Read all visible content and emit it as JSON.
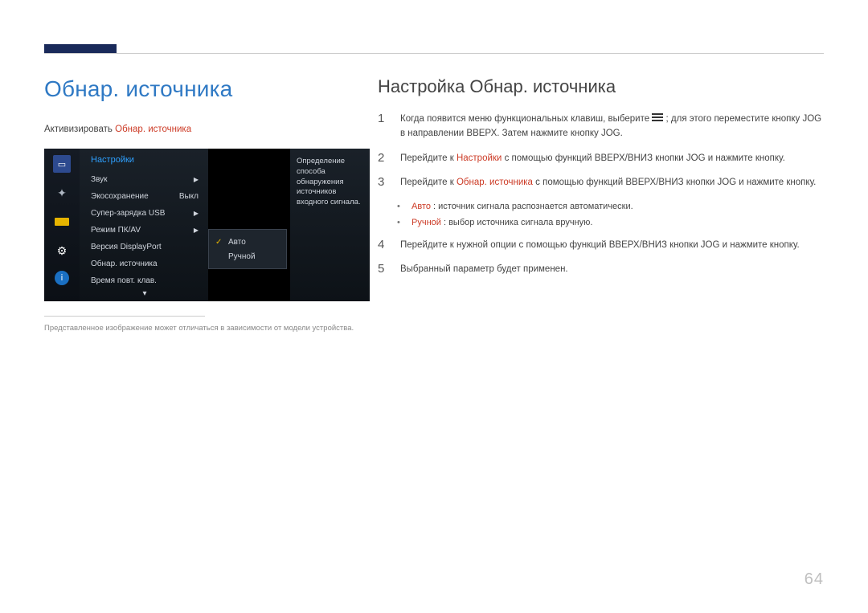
{
  "topic_title": "Обнар. источника",
  "activate_label": "Активизировать",
  "activate_path": "Обнар. источника",
  "osd": {
    "title": "Настройки",
    "rows": [
      {
        "label": "Звук",
        "value_kind": "arrow"
      },
      {
        "label": "Экосохранение",
        "value_kind": "text",
        "value": "Выкл"
      },
      {
        "label": "Супер-зарядка USB",
        "value_kind": "arrow"
      },
      {
        "label": "Режим ПК/AV",
        "value_kind": "arrow"
      },
      {
        "label": "Версия DisplayPort",
        "value_kind": "none"
      },
      {
        "label": "Обнар. источника",
        "value_kind": "none"
      },
      {
        "label": "Время повт. клав.",
        "value_kind": "none"
      }
    ],
    "popup": {
      "options": [
        "Авто",
        "Ручной"
      ],
      "selected_index": 0
    },
    "description": "Определение способа обнаружения источников входного сигнала."
  },
  "footnote": "Представленное изображение может отличаться в зависимости от модели устройства.",
  "section_title": "Настройка Обнар. источника",
  "steps": {
    "s1_a": "Когда появится меню функциональных клавиш, выберите ",
    "s1_b": " ; для этого переместите кнопку JOG в направлении ВВЕРХ. Затем нажмите кнопку JOG.",
    "s2_a": "Перейдите к ",
    "s2_nav": "Настройки",
    "s2_b": " с помощью функций ВВЕРХ/ВНИЗ кнопки JOG и нажмите кнопку.",
    "s3_a": "Перейдите к ",
    "s3_nav": "Обнар. источника",
    "s3_b": " с помощью функций ВВЕРХ/ВНИЗ кнопки JOG и нажмите кнопку.",
    "b1_tag": "Авто",
    "b1_txt": ": источник сигнала распознается автоматически.",
    "b2_tag": "Ручной",
    "b2_txt": ": выбор источника сигнала вручную.",
    "s4": "Перейдите к нужной опции с помощью функций ВВЕРХ/ВНИЗ кнопки JOG и нажмите кнопку.",
    "s5": "Выбранный параметр будет применен."
  },
  "page_number": "64"
}
